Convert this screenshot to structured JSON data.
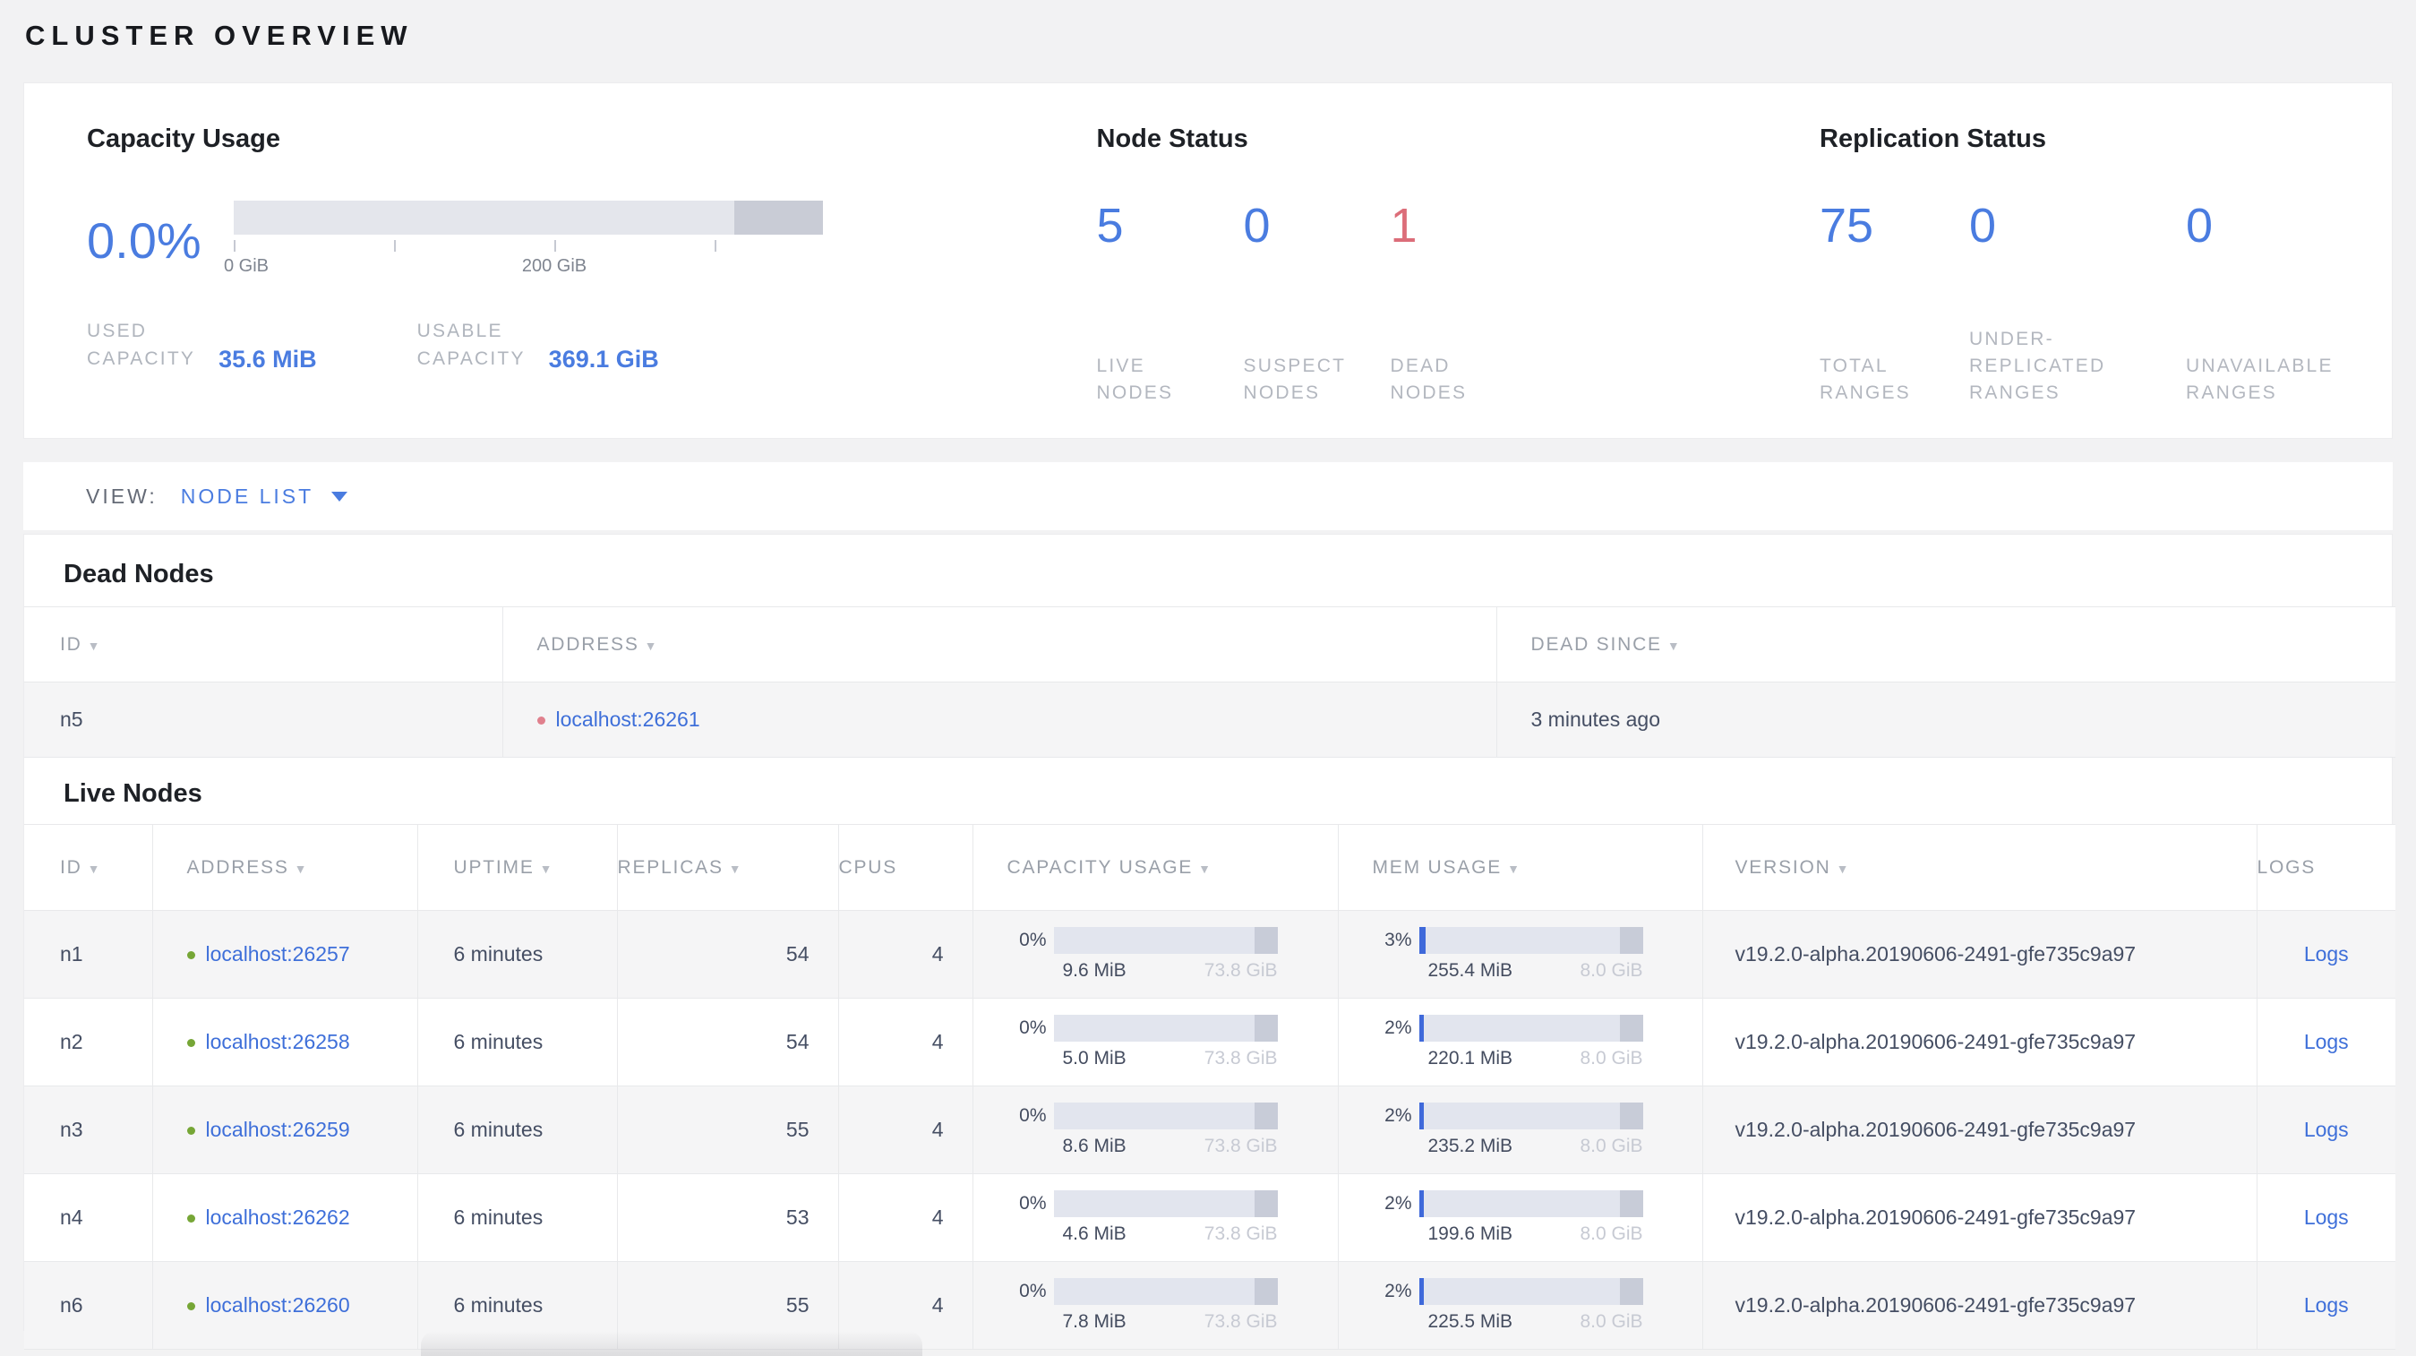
{
  "colors": {
    "accent_blue": "#4a7ce0",
    "link_blue": "#3e6fd9",
    "danger_red": "#dc6d79",
    "live_dot_green": "#76a636",
    "dead_dot_red": "#e0808d"
  },
  "page_title": "CLUSTER OVERVIEW",
  "summary": {
    "capacity": {
      "title": "Capacity Usage",
      "percent": "0.0%",
      "axis_labels": [
        {
          "label": "0 GiB"
        },
        {
          "label": "200 GiB"
        }
      ],
      "metrics": [
        {
          "label": "USED\nCAPACITY",
          "value": "35.6 MiB"
        },
        {
          "label": "USABLE\nCAPACITY",
          "value": "369.1 GiB"
        }
      ]
    },
    "node_status": {
      "title": "Node Status",
      "stats": [
        {
          "value": "5",
          "label": "LIVE\nNODES"
        },
        {
          "value": "0",
          "label": "SUSPECT\nNODES"
        },
        {
          "value": "1",
          "label": "DEAD\nNODES"
        }
      ]
    },
    "replication": {
      "title": "Replication Status",
      "stats": [
        {
          "value": "75",
          "label": "TOTAL\nRANGES"
        },
        {
          "value": "0",
          "label": "UNDER-\nREPLICATED\nRANGES"
        },
        {
          "value": "0",
          "label": "UNAVAILABLE\nRANGES"
        }
      ]
    }
  },
  "view_bar": {
    "label": "VIEW:",
    "selected": "NODE LIST"
  },
  "dead_nodes": {
    "heading": "Dead Nodes",
    "columns": [
      {
        "label": "ID"
      },
      {
        "label": "ADDRESS"
      },
      {
        "label": "DEAD SINCE"
      }
    ],
    "rows": [
      {
        "id": "n5",
        "address": "localhost:26261",
        "dead_since": "3 minutes ago"
      }
    ]
  },
  "live_nodes": {
    "heading": "Live Nodes",
    "columns": [
      {
        "label": "ID"
      },
      {
        "label": "ADDRESS"
      },
      {
        "label": "UPTIME"
      },
      {
        "label": "REPLICAS"
      },
      {
        "label": "CPUS"
      },
      {
        "label": "CAPACITY USAGE"
      },
      {
        "label": "MEM USAGE"
      },
      {
        "label": "VERSION"
      },
      {
        "label": "LOGS"
      }
    ],
    "rows": [
      {
        "id": "n1",
        "address": "localhost:26257",
        "uptime": "6 minutes",
        "replicas": "54",
        "cpus": "4",
        "capacity": {
          "percent": "0%",
          "used": "9.6 MiB",
          "total": "73.8 GiB",
          "used_pct_num": 0
        },
        "mem": {
          "percent": "3%",
          "used": "255.4 MiB",
          "total": "8.0 GiB",
          "used_pct_num": 3
        },
        "version": "v19.2.0-alpha.20190606-2491-gfe735c9a97",
        "logs": "Logs"
      },
      {
        "id": "n2",
        "address": "localhost:26258",
        "uptime": "6 minutes",
        "replicas": "54",
        "cpus": "4",
        "capacity": {
          "percent": "0%",
          "used": "5.0 MiB",
          "total": "73.8 GiB",
          "used_pct_num": 0
        },
        "mem": {
          "percent": "2%",
          "used": "220.1 MiB",
          "total": "8.0 GiB",
          "used_pct_num": 2
        },
        "version": "v19.2.0-alpha.20190606-2491-gfe735c9a97",
        "logs": "Logs"
      },
      {
        "id": "n3",
        "address": "localhost:26259",
        "uptime": "6 minutes",
        "replicas": "55",
        "cpus": "4",
        "capacity": {
          "percent": "0%",
          "used": "8.6 MiB",
          "total": "73.8 GiB",
          "used_pct_num": 0
        },
        "mem": {
          "percent": "2%",
          "used": "235.2 MiB",
          "total": "8.0 GiB",
          "used_pct_num": 2
        },
        "version": "v19.2.0-alpha.20190606-2491-gfe735c9a97",
        "logs": "Logs"
      },
      {
        "id": "n4",
        "address": "localhost:26262",
        "uptime": "6 minutes",
        "replicas": "53",
        "cpus": "4",
        "capacity": {
          "percent": "0%",
          "used": "4.6 MiB",
          "total": "73.8 GiB",
          "used_pct_num": 0
        },
        "mem": {
          "percent": "2%",
          "used": "199.6 MiB",
          "total": "8.0 GiB",
          "used_pct_num": 2
        },
        "version": "v19.2.0-alpha.20190606-2491-gfe735c9a97",
        "logs": "Logs"
      },
      {
        "id": "n6",
        "address": "localhost:26260",
        "uptime": "6 minutes",
        "replicas": "55",
        "cpus": "4",
        "capacity": {
          "percent": "0%",
          "used": "7.8 MiB",
          "total": "73.8 GiB",
          "used_pct_num": 0
        },
        "mem": {
          "percent": "2%",
          "used": "225.5 MiB",
          "total": "8.0 GiB",
          "used_pct_num": 2
        },
        "version": "v19.2.0-alpha.20190606-2491-gfe735c9a97",
        "logs": "Logs"
      }
    ]
  }
}
